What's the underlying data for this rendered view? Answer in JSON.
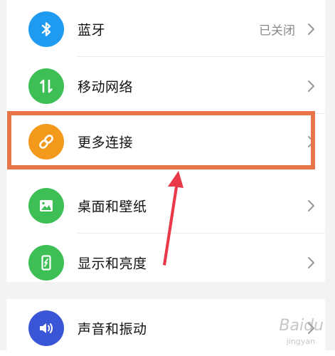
{
  "settings": {
    "items": [
      {
        "label": "蓝牙",
        "value": "已关闭",
        "icon": "bluetooth-icon",
        "color": "#1e9bf0"
      },
      {
        "label": "移动网络",
        "value": "",
        "icon": "mobile-network-icon",
        "color": "#3dbf55"
      },
      {
        "label": "更多连接",
        "value": "",
        "icon": "link-icon",
        "color": "#f39a1c"
      },
      {
        "label": "桌面和壁纸",
        "value": "",
        "icon": "image-icon",
        "color": "#3dbf55"
      },
      {
        "label": "显示和亮度",
        "value": "",
        "icon": "display-icon",
        "color": "#3dbf55"
      },
      {
        "label": "声音和振动",
        "value": "",
        "icon": "sound-icon",
        "color": "#3a56d6"
      }
    ]
  },
  "annotation": {
    "highlight_color": "#e8744a",
    "arrow_color": "#e8384a"
  },
  "watermark": {
    "text": "Baidu",
    "sub": "jingyan"
  }
}
